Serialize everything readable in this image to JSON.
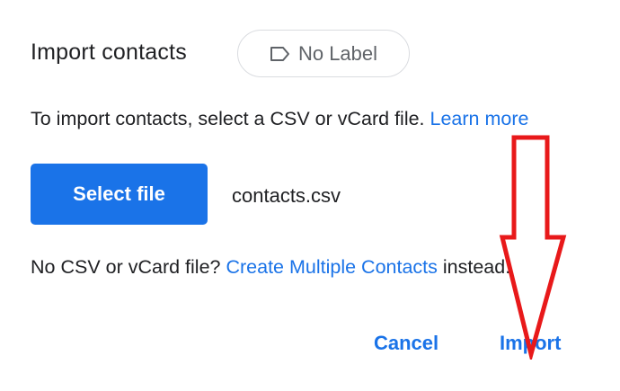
{
  "dialog": {
    "title": "Import contacts",
    "label_chip": {
      "icon": "label-icon",
      "text": "No Label"
    },
    "instructions": {
      "text": "To import contacts, select a CSV or vCard file.",
      "link": "Learn more"
    },
    "select_file_label": "Select file",
    "selected_file": "contacts.csv",
    "no_file": {
      "prefix": "No CSV or vCard file?",
      "link": "Create Multiple Contacts",
      "suffix": "instead."
    },
    "actions": {
      "cancel": "Cancel",
      "import": "Import"
    }
  },
  "annotation": {
    "arrow_color": "#e8191a",
    "arrow_icon": "arrow-down-outline"
  },
  "colors": {
    "accent": "#1a73e8",
    "text": "#202124",
    "muted": "#5f6368",
    "border": "#dadce0"
  }
}
